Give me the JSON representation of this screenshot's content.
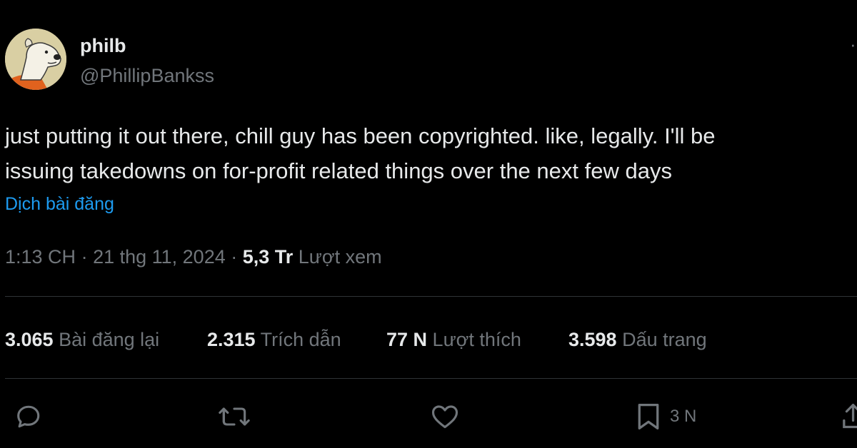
{
  "author": {
    "display_name": "philb",
    "handle": "@PhillipBankss"
  },
  "tweet": {
    "line1": "just putting it out there, chill guy has been copyrighted. like, legally. I'll be",
    "line2": "issuing takedowns on for-profit related things over the next few days",
    "translate_label": "Dịch bài đăng"
  },
  "meta": {
    "time": "1:13 CH",
    "sep1": " · ",
    "date": "21 thg 11, 2024",
    "sep2": " · ",
    "views_count": "5,3 Tr",
    "views_label": " Lượt xem"
  },
  "stats": {
    "reposts": {
      "count": "3.065",
      "label": " Bài đăng lại"
    },
    "quotes": {
      "count": "2.315",
      "label": " Trích dẫn"
    },
    "likes": {
      "count": "77 N",
      "label": " Lượt thích"
    },
    "bookmarks": {
      "count": "3.598",
      "label": " Dấu trang"
    }
  },
  "actions": {
    "bookmark_count": "3 N"
  },
  "icons": {
    "reply": "reply-icon",
    "repost": "repost-icon",
    "like": "heart-icon",
    "bookmark": "bookmark-icon",
    "share": "share-icon",
    "more": "more-icon"
  },
  "colors": {
    "background": "#000000",
    "text": "#e7e9ea",
    "secondary": "#71767b",
    "link": "#1d9bf0",
    "divider": "#2f3336"
  }
}
